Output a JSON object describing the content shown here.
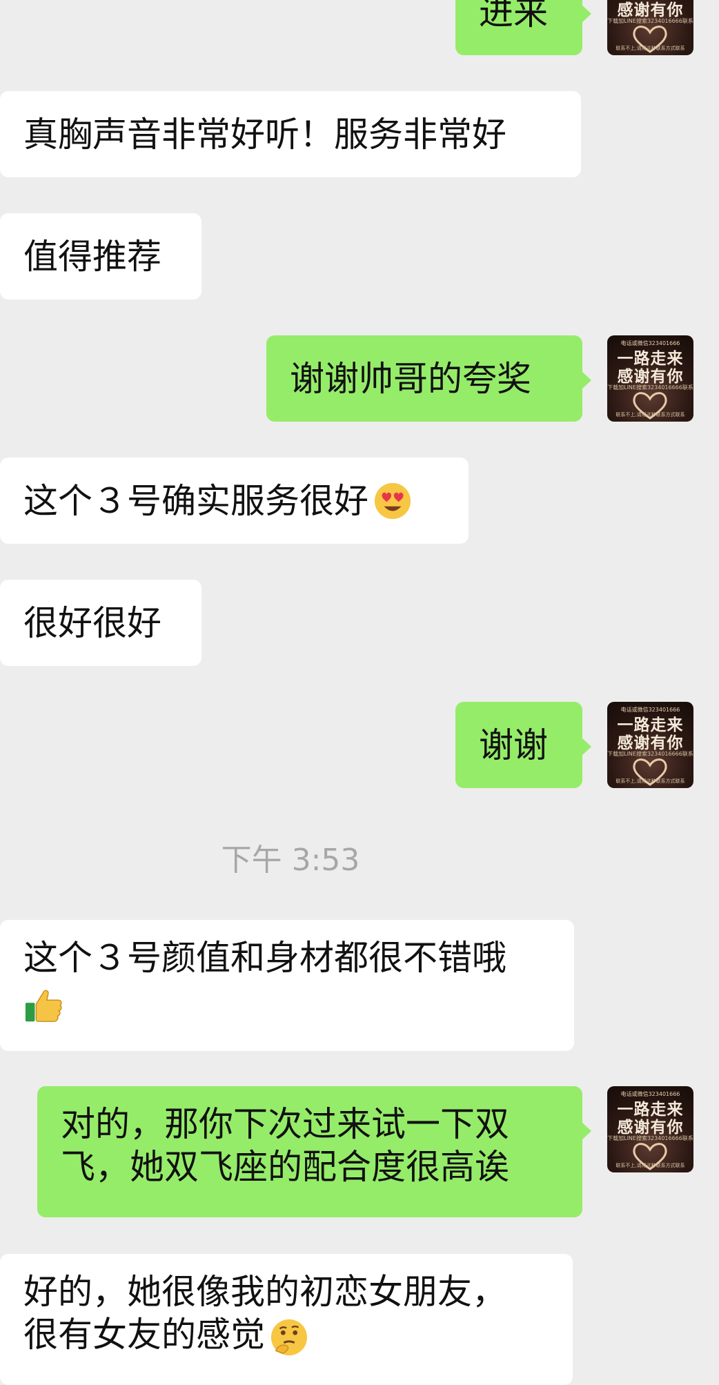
{
  "avatar": {
    "line1": "一路走来",
    "line2": "感谢有你",
    "top_text": "电话或微信323401666",
    "small_text": "下载加LINE搜索3234016666联系",
    "bottom_text": "联系不上,请用这种联系方式联系"
  },
  "messages": [
    {
      "side": "sent",
      "text": "进来"
    },
    {
      "side": "recv",
      "text": "真胸声音非常好听！服务非常好"
    },
    {
      "side": "recv",
      "text": "值得推荐"
    },
    {
      "side": "sent",
      "text": "谢谢帅哥的夸奖"
    },
    {
      "side": "recv",
      "text": "这个３号确实服务很好",
      "emoji": "heart-eyes-emoji"
    },
    {
      "side": "recv",
      "text": "很好很好"
    },
    {
      "side": "sent",
      "text": "谢谢"
    },
    {
      "side": "recv",
      "lines": [
        "这个３号颜值和身材都很不错哦"
      ],
      "emoji": "thumbs-up-emoji"
    },
    {
      "side": "sent",
      "lines": [
        "对的，那你下次过来试一下双",
        "飞，她双飞座的配合度很高诶"
      ]
    },
    {
      "side": "recv",
      "lines": [
        "好的，她很像我的初恋女朋友，",
        "很有女友的感觉"
      ],
      "emoji": "thinking-face-emoji"
    }
  ],
  "timestamp": "下午 3:53"
}
